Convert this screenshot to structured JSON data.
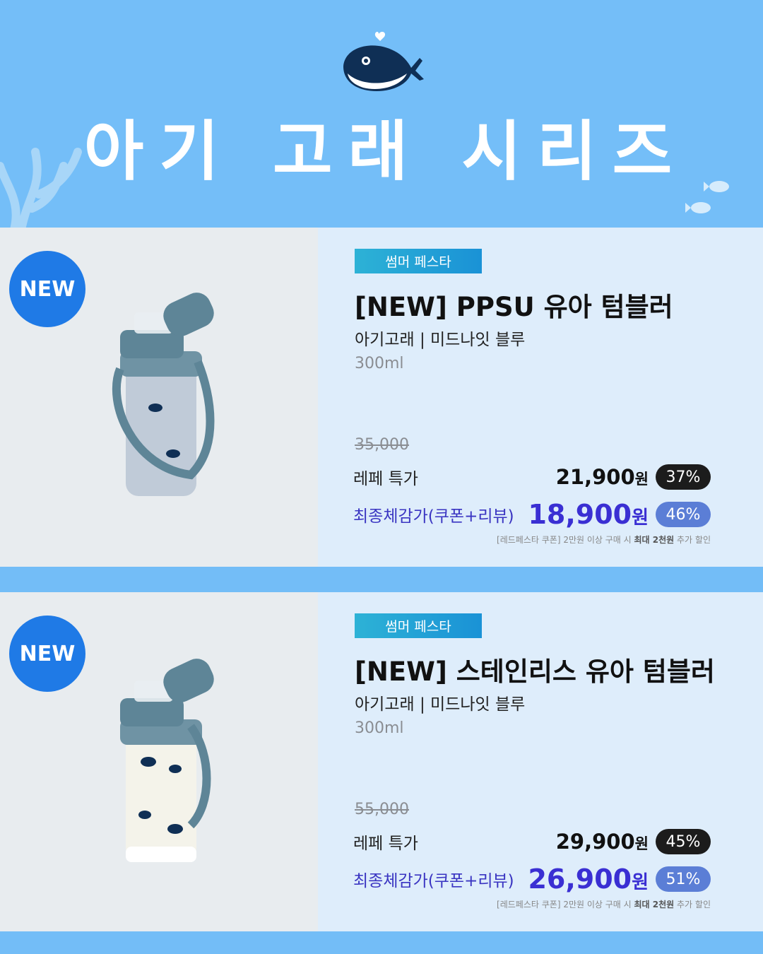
{
  "header": {
    "title": "아기 고래 시리즈"
  },
  "products": [
    {
      "badge": "NEW",
      "promo": "썸머 페스타",
      "name": "[NEW] PPSU 유아 텀블러",
      "subtitle": "아기고래 | 미드나잇 블루",
      "volume": "300ml",
      "original_price": "35,000",
      "special_label": "레페 특가",
      "special_price": "21,900",
      "special_pct": "37%",
      "final_label": "최종체감가(쿠폰+리뷰)",
      "final_price": "18,900",
      "final_pct": "46%",
      "currency": "원",
      "note_pre": "[레드페스타 쿠폰] 2만원 이상 구매 시 ",
      "note_bold": "최대 2천원",
      "note_post": " 추가 할인"
    },
    {
      "badge": "NEW",
      "promo": "썸머 페스타",
      "name": "[NEW] 스테인리스 유아 텀블러",
      "subtitle": "아기고래 | 미드나잇 블루",
      "volume": "300ml",
      "original_price": "55,000",
      "special_label": "레페 특가",
      "special_price": "29,900",
      "special_pct": "45%",
      "final_label": "최종체감가(쿠폰+리뷰)",
      "final_price": "26,900",
      "final_pct": "51%",
      "currency": "원",
      "note_pre": "[레드페스타 쿠폰] 2만원 이상 구매 시 ",
      "note_bold": "최대 2천원",
      "note_post": " 추가 할인"
    }
  ],
  "colors": {
    "background": "#74bef8",
    "badge": "#1f7ae6",
    "final_price": "#3a2fd3"
  }
}
